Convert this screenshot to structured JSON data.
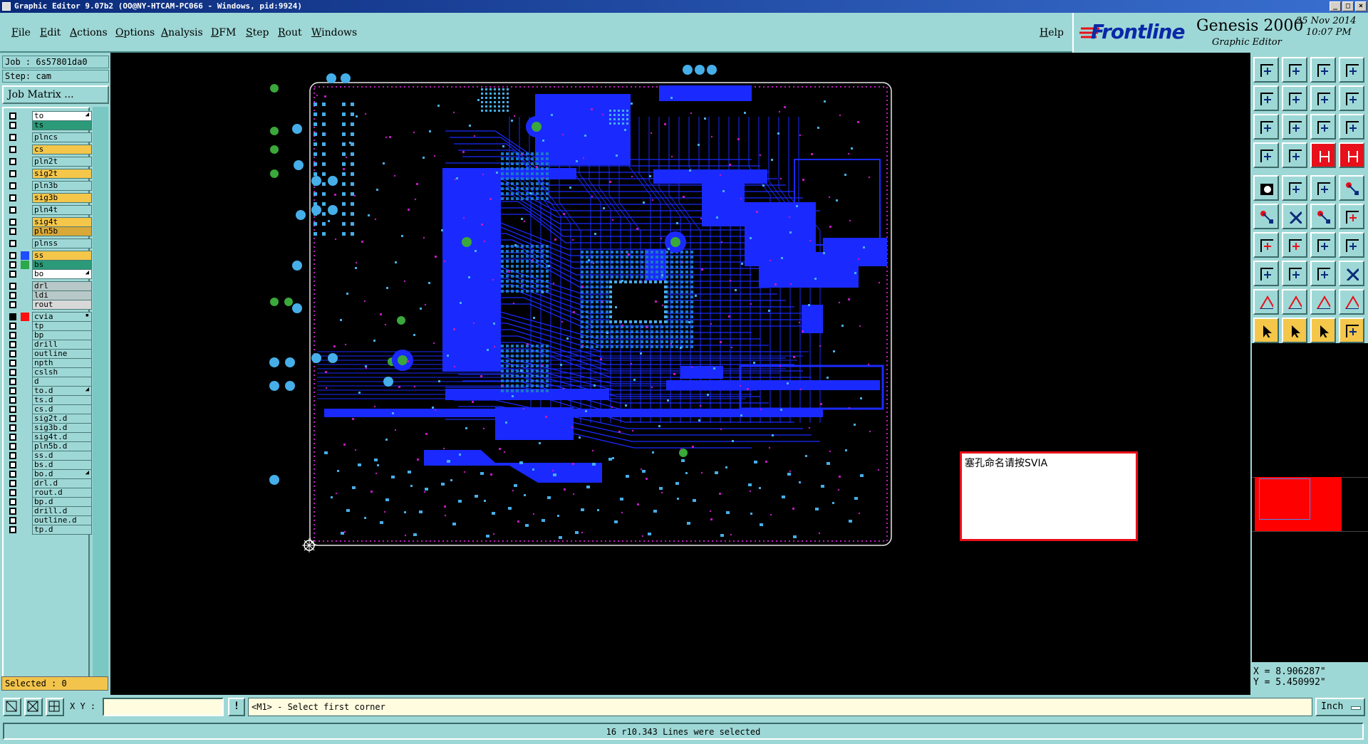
{
  "window": {
    "title": "Graphic Editor 9.07b2 (OO@NY-HTCAM-PC066 - Windows, pid:9924)",
    "min": "_",
    "max": "□",
    "close": "×"
  },
  "menu": [
    "File",
    "Edit",
    "Actions",
    "Options",
    "Analysis",
    "DFM",
    "Step",
    "Rout",
    "Windows"
  ],
  "help_label": "Help",
  "logo": {
    "brand": "Frontline",
    "product": "Genesis 2000",
    "module": "Graphic Editor",
    "date": "25 Nov 2014",
    "time": "10:07 PM"
  },
  "left": {
    "job": "Job : 6s57801da0",
    "step": "Step: cam",
    "job_matrix": "Job Matrix ...",
    "selected": "Selected : 0"
  },
  "layers": [
    {
      "name": "to",
      "color": "#ffffff",
      "swatch": "",
      "mark": "◢"
    },
    {
      "name": "ts",
      "color": "#2a9a78",
      "swatch": ""
    },
    {
      "name": "plncs",
      "color": "#9ed8d6",
      "swatch": ""
    },
    {
      "name": "cs",
      "color": "#f4c64a",
      "swatch": ""
    },
    {
      "name": "pln2t",
      "color": "#9ed8d6",
      "swatch": ""
    },
    {
      "name": "sig2t",
      "color": "#f4c64a",
      "swatch": ""
    },
    {
      "name": "pln3b",
      "color": "#9ed8d6",
      "swatch": ""
    },
    {
      "name": "sig3b",
      "color": "#f4c64a",
      "swatch": ""
    },
    {
      "name": "pln4t",
      "color": "#9ed8d6",
      "swatch": ""
    },
    {
      "name": "sig4t",
      "color": "#f4c64a",
      "swatch": ""
    },
    {
      "name": "pln5b",
      "color": "#d8a838",
      "swatch": ""
    },
    {
      "name": "plnss",
      "color": "#9ed8d6",
      "swatch": ""
    },
    {
      "name": "ss",
      "color": "#f4c64a",
      "swatch": "#1e4cff"
    },
    {
      "name": "bs",
      "color": "#2a9a78",
      "swatch": "#2aa84a"
    },
    {
      "name": "bo",
      "color": "#ffffff",
      "swatch": "",
      "mark": "◢"
    },
    {
      "name": "drl",
      "color": "#b8c8c8",
      "swatch": ""
    },
    {
      "name": "ldi",
      "color": "#b8c8c8",
      "swatch": ""
    },
    {
      "name": "rout",
      "color": "#d8d8d8",
      "swatch": ""
    },
    {
      "name": "cvia",
      "color": "#9ed8d6",
      "swatch": "#ff1010",
      "mark": "▪"
    },
    {
      "name": "tp",
      "color": "#9ed8d6",
      "swatch": ""
    },
    {
      "name": "bp",
      "color": "#9ed8d6",
      "swatch": ""
    },
    {
      "name": "drill",
      "color": "#9ed8d6",
      "swatch": ""
    },
    {
      "name": "outline",
      "color": "#9ed8d6",
      "swatch": ""
    },
    {
      "name": "npth",
      "color": "#9ed8d6",
      "swatch": ""
    },
    {
      "name": "cslsh",
      "color": "#9ed8d6",
      "swatch": ""
    },
    {
      "name": "d",
      "color": "#9ed8d6",
      "swatch": ""
    },
    {
      "name": "to.d",
      "color": "#9ed8d6",
      "swatch": "",
      "mark": "◢"
    },
    {
      "name": "ts.d",
      "color": "#9ed8d6",
      "swatch": ""
    },
    {
      "name": "cs.d",
      "color": "#9ed8d6",
      "swatch": ""
    },
    {
      "name": "sig2t.d",
      "color": "#9ed8d6",
      "swatch": ""
    },
    {
      "name": "sig3b.d",
      "color": "#9ed8d6",
      "swatch": ""
    },
    {
      "name": "sig4t.d",
      "color": "#9ed8d6",
      "swatch": ""
    },
    {
      "name": "pln5b.d",
      "color": "#9ed8d6",
      "swatch": ""
    },
    {
      "name": "ss.d",
      "color": "#9ed8d6",
      "swatch": ""
    },
    {
      "name": "bs.d",
      "color": "#9ed8d6",
      "swatch": ""
    },
    {
      "name": "bo.d",
      "color": "#9ed8d6",
      "swatch": "",
      "mark": "◢"
    },
    {
      "name": "drl.d",
      "color": "#9ed8d6",
      "swatch": ""
    },
    {
      "name": "rout.d",
      "color": "#9ed8d6",
      "swatch": ""
    },
    {
      "name": "bp.d",
      "color": "#9ed8d6",
      "swatch": ""
    },
    {
      "name": "drill.d",
      "color": "#9ed8d6",
      "swatch": ""
    },
    {
      "name": "outline.d",
      "color": "#9ed8d6",
      "swatch": ""
    },
    {
      "name": "tp.d",
      "color": "#9ed8d6",
      "swatch": ""
    }
  ],
  "popup": {
    "text": "塞孔命名请按SVIA"
  },
  "coords": {
    "x": "X = 8.906287\"",
    "y": "Y = 5.450992\""
  },
  "cmd": {
    "xy_label": "X Y :",
    "xy_value": "",
    "prompt": "<M1> - Select first corner",
    "unit": "Inch"
  },
  "status": "16 r10.343 Lines were selected",
  "tools": [
    "open-job-icon",
    "save-icon",
    "home-icon",
    "window-layout-icon",
    "zoom-left-icon",
    "zoom-right-icon",
    "pan-icon",
    "snap-icon",
    "fit-all-icon",
    "center-icon",
    "scale-1-2-icon",
    "help-icon",
    "measure-icon",
    "grid-icon",
    "layer-red-icon",
    "layer-red2-icon",
    "camera-icon",
    "diamond-icon",
    "line-dash-icon",
    "dot-icon",
    "connect-icon",
    "cross-icon",
    "red-dot-icon",
    "line-red-icon",
    "angle-icon",
    "slash-icon",
    "rotate-icon",
    "mirror-icon",
    "pad-icon",
    "minus-icon",
    "resize-icon",
    "square-cross-icon",
    "triangle-1-icon",
    "triangle-2-icon",
    "triangle-3-icon",
    "triangle-4-icon",
    "pointer-1-icon",
    "pointer-2-icon",
    "pointer-3-icon",
    "route-icon"
  ],
  "colors": {
    "board_blue": "#1a2aff",
    "pad_cyan": "#46aee8",
    "pad_green": "#3aa83a",
    "silk_magenta": "#c01ac0",
    "accent_red": "#e8101a"
  }
}
